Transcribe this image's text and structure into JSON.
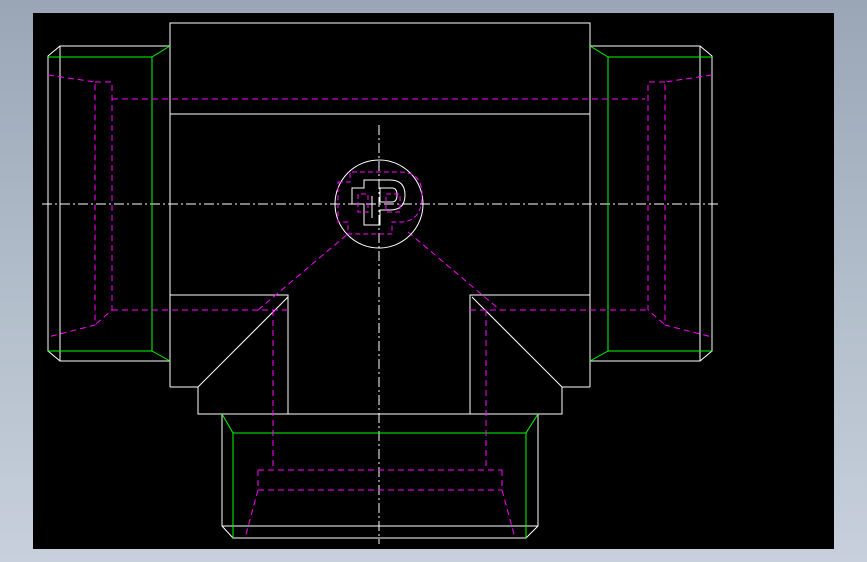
{
  "drawing": {
    "background_color": "#000000",
    "frame_gradient": [
      "#9aa6b6",
      "#c7d0dc"
    ],
    "colors": {
      "visible_edge": "#ffffff",
      "thread_edge": "#00ff00",
      "hidden_edge": "#ff00ff",
      "centerline": "#ffffff"
    },
    "views": [
      "front-view"
    ],
    "parts": [
      "tee-body",
      "left-port",
      "right-port",
      "bottom-port",
      "logo-emblem"
    ]
  }
}
